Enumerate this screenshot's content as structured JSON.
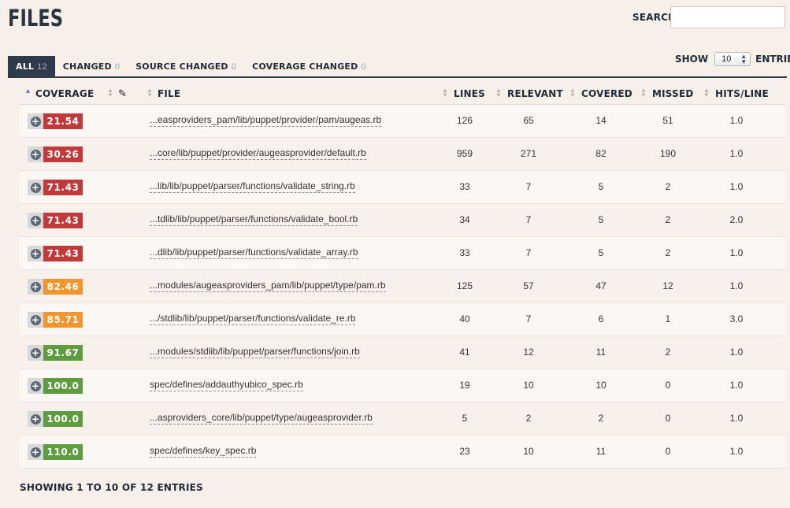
{
  "page": {
    "title": "FILES"
  },
  "search": {
    "label": "SEARCH:",
    "value": "",
    "placeholder": ""
  },
  "tabs": [
    {
      "label": "ALL",
      "count": "12"
    },
    {
      "label": "CHANGED",
      "count": "0"
    },
    {
      "label": "SOURCE CHANGED",
      "count": "0"
    },
    {
      "label": "COVERAGE CHANGED",
      "count": "0"
    }
  ],
  "show": {
    "label": "SHOW",
    "value": "10",
    "suffix": "ENTRIES"
  },
  "columns": {
    "coverage": "COVERAGE",
    "file": "FILE",
    "lines": "LINES",
    "relevant": "RELEVANT",
    "covered": "COVERED",
    "missed": "MISSED",
    "hits_per_line": "HITS/LINE"
  },
  "rows": [
    {
      "coverage": "21.54",
      "level": "red",
      "file": "...easproviders_pam/lib/puppet/provider/pam/augeas.rb",
      "lines": "126",
      "relevant": "65",
      "covered": "14",
      "missed": "51",
      "hits": "1.0"
    },
    {
      "coverage": "30.26",
      "level": "red",
      "file": "...core/lib/puppet/provider/augeasprovider/default.rb",
      "lines": "959",
      "relevant": "271",
      "covered": "82",
      "missed": "190",
      "hits": "1.0"
    },
    {
      "coverage": "71.43",
      "level": "red",
      "file": "...lib/lib/puppet/parser/functions/validate_string.rb",
      "lines": "33",
      "relevant": "7",
      "covered": "5",
      "missed": "2",
      "hits": "1.0"
    },
    {
      "coverage": "71.43",
      "level": "red",
      "file": "...tdlib/lib/puppet/parser/functions/validate_bool.rb",
      "lines": "34",
      "relevant": "7",
      "covered": "5",
      "missed": "2",
      "hits": "2.0"
    },
    {
      "coverage": "71.43",
      "level": "red",
      "file": "...dlib/lib/puppet/parser/functions/validate_array.rb",
      "lines": "33",
      "relevant": "7",
      "covered": "5",
      "missed": "2",
      "hits": "1.0"
    },
    {
      "coverage": "82.46",
      "level": "orange",
      "file": "...modules/augeasproviders_pam/lib/puppet/type/pam.rb",
      "lines": "125",
      "relevant": "57",
      "covered": "47",
      "missed": "12",
      "hits": "1.0"
    },
    {
      "coverage": "85.71",
      "level": "orange",
      "file": ".../stdlib/lib/puppet/parser/functions/validate_re.rb",
      "lines": "40",
      "relevant": "7",
      "covered": "6",
      "missed": "1",
      "hits": "3.0"
    },
    {
      "coverage": "91.67",
      "level": "green",
      "file": "...modules/stdlib/lib/puppet/parser/functions/join.rb",
      "lines": "41",
      "relevant": "12",
      "covered": "11",
      "missed": "2",
      "hits": "1.0"
    },
    {
      "coverage": "100.0",
      "level": "green",
      "file": "spec/defines/addauthyubico_spec.rb",
      "lines": "19",
      "relevant": "10",
      "covered": "10",
      "missed": "0",
      "hits": "1.0"
    },
    {
      "coverage": "100.0",
      "level": "green",
      "file": "...asproviders_core/lib/puppet/type/augeasprovider.rb",
      "lines": "5",
      "relevant": "2",
      "covered": "2",
      "missed": "0",
      "hits": "1.0"
    },
    {
      "coverage": "110.0",
      "level": "green",
      "file": "spec/defines/key_spec.rb",
      "lines": "23",
      "relevant": "10",
      "covered": "11",
      "missed": "0",
      "hits": "1.0"
    }
  ],
  "footer": {
    "info": "SHOWING 1 TO 10 OF 12 ENTRIES"
  },
  "colors": {
    "red": "#c0393b",
    "orange": "#f2952c",
    "green": "#5e9c3f",
    "header": "#2e3b4a"
  }
}
